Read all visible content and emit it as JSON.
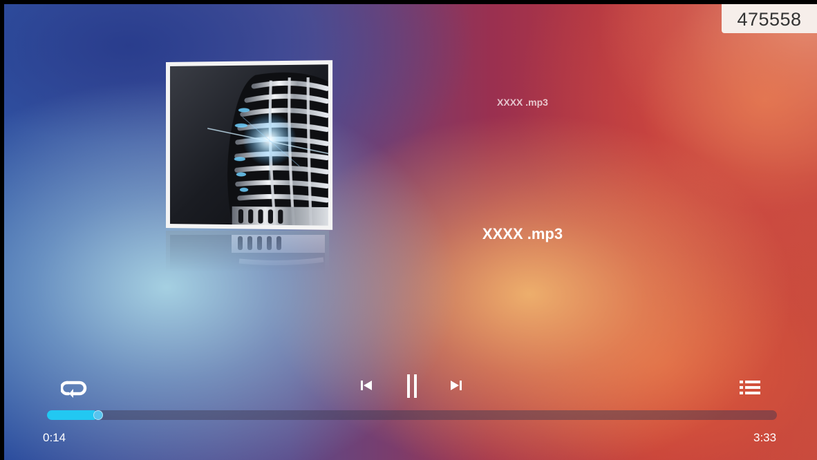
{
  "counter": "475558",
  "track": {
    "title_small": "XXXX .mp3",
    "title_large": "XXXX .mp3"
  },
  "playback": {
    "elapsed": "0:14",
    "total": "3:33",
    "progress_fraction": 0.066
  },
  "icons": {
    "repeat": "repeat-icon",
    "previous": "skip-previous-icon",
    "pause": "pause-icon",
    "next": "skip-next-icon",
    "playlist": "playlist-icon"
  },
  "colors": {
    "progress_fill": "#22c8f2",
    "progress_track": "rgba(60,55,80,0.45)"
  }
}
